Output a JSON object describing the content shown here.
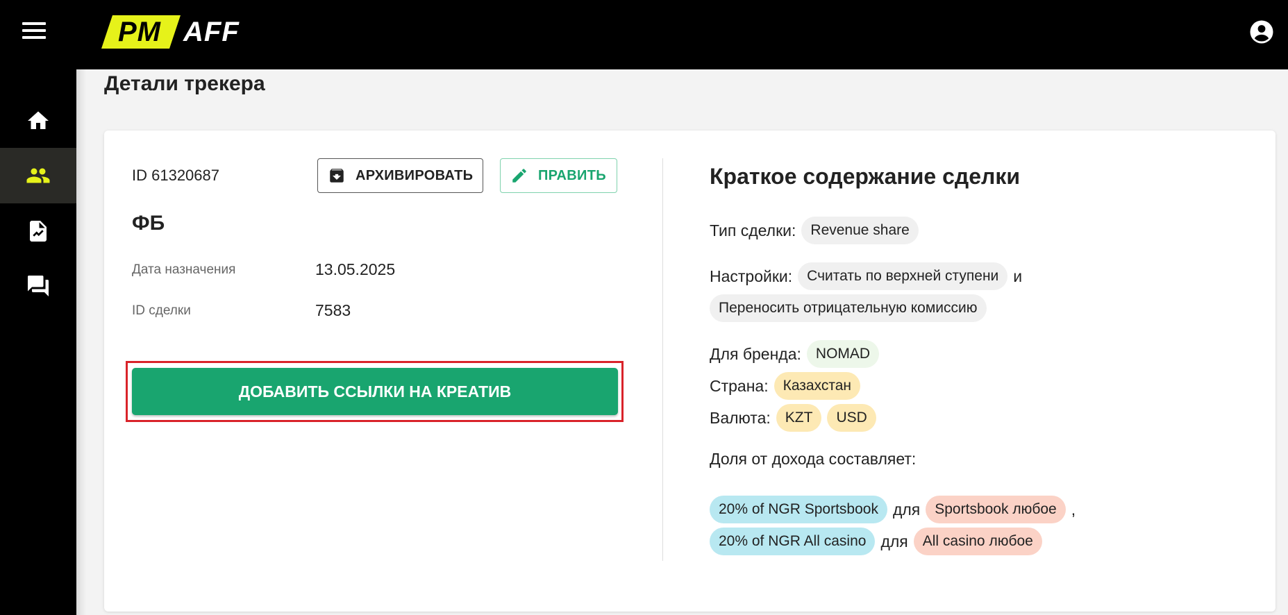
{
  "app": {
    "logo_pm": "PM",
    "logo_aff": "AFF"
  },
  "sidebar": {
    "items": [
      {
        "name": "home",
        "icon": "home-icon",
        "active": false
      },
      {
        "name": "partners",
        "icon": "people-icon",
        "active": true
      },
      {
        "name": "reports",
        "icon": "report-icon",
        "active": false
      },
      {
        "name": "messages",
        "icon": "chat-icon",
        "active": false
      }
    ]
  },
  "page": {
    "title": "Детали трекера"
  },
  "tracker": {
    "id_text": "ID 61320687",
    "archive_label": "АРХИВИРОВАТЬ",
    "edit_label": "ПРАВИТЬ",
    "name": "ФБ",
    "fields": [
      {
        "label": "Дата назначения",
        "value": "13.05.2025"
      },
      {
        "label": "ID сделки",
        "value": "7583"
      }
    ],
    "add_links_label": "ДОБАВИТЬ ССЫЛКИ НА КРЕАТИВ"
  },
  "summary": {
    "title": "Краткое содержание сделки",
    "deal_type_label": "Тип сделки:",
    "deal_type_value": "Revenue share",
    "settings_label": "Настройки:",
    "settings_1": "Считать по верхней ступени",
    "settings_joiner": "и",
    "settings_2": "Переносить отрицательную комиссию",
    "brand_label": "Для бренда:",
    "brand_value": "NOMAD",
    "country_label": "Страна:",
    "country_value": "Казахстан",
    "currency_label": "Валюта:",
    "currencies": [
      "KZT",
      "USD"
    ],
    "revenue_label": "Доля от дохода составляет:",
    "revenue_rows": [
      {
        "share": "20% of NGR Sportsbook",
        "joiner": "для",
        "target": "Sportsbook любое",
        "trail": ","
      },
      {
        "share": "20% of NGR All casino",
        "joiner": "для",
        "target": "All casino любое",
        "trail": ""
      }
    ]
  },
  "colors": {
    "accent_green": "#19a56f",
    "logo_yellow": "#e6f21a",
    "highlight_red": "#d9232a"
  }
}
